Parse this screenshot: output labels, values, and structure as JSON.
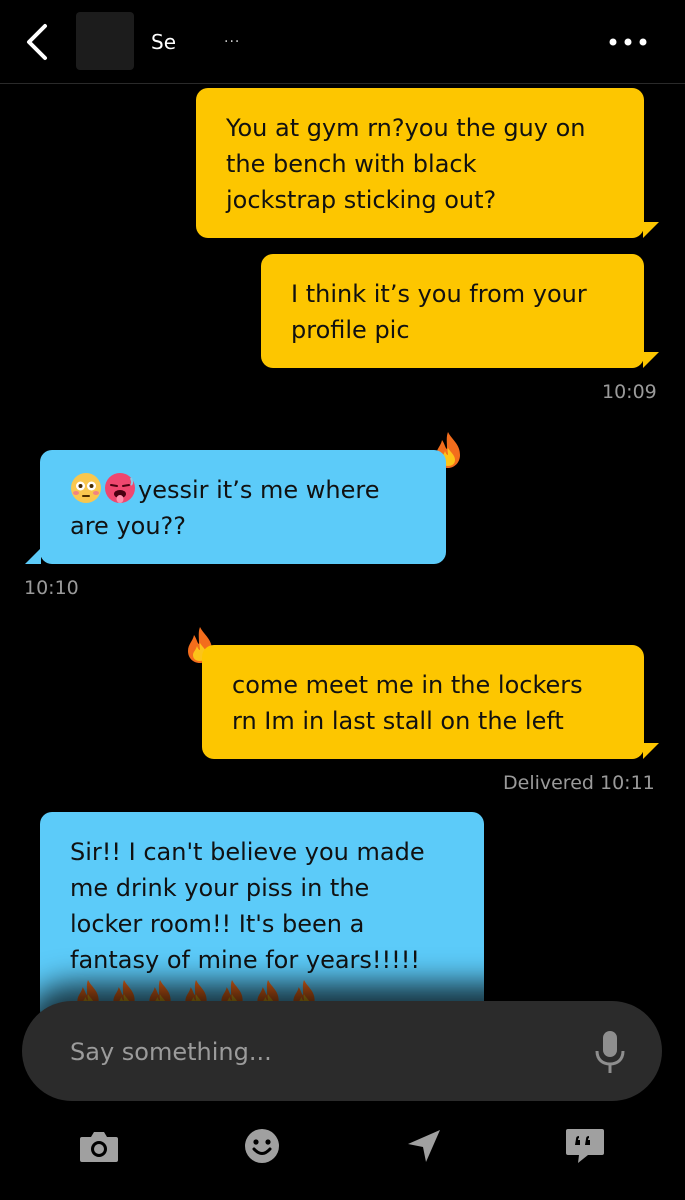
{
  "header": {
    "contact_name": "Se",
    "contact_extra": "...",
    "back_icon": "chevron-left-icon",
    "more_icon": "more-horizontal-icon"
  },
  "messages": [
    {
      "direction": "outgoing",
      "text": "You at gym rn?you the guy on the bench with black jockstrap sticking out?",
      "lines": [
        "You at gym rn?you the guy on",
        "the bench with black",
        "jockstrap sticking out?"
      ]
    },
    {
      "direction": "outgoing",
      "text": "I think it’s you from your profile pic",
      "lines": [
        "I think it’s you from your",
        "profile pic"
      ],
      "time": "10:09"
    },
    {
      "direction": "incoming",
      "emoji": [
        "flushed-face-emoji",
        "hot-face-emoji"
      ],
      "lines": [
        "yessir it’s me where",
        "are you??"
      ],
      "reaction": "fire-icon",
      "time": "10:10"
    },
    {
      "direction": "outgoing",
      "lines": [
        "come meet me in the lockers",
        "rn Im in last stall on the left"
      ],
      "reaction": "fire-icon",
      "status": "Delivered 10:11"
    },
    {
      "direction": "incoming",
      "lines": [
        "Sir!! I can't believe you made",
        "me drink your piss in the",
        "locker room!! It's been a",
        "fantasy of mine for years!!!!!"
      ],
      "trailing_emoji": "fire-emoji x7"
    }
  ],
  "composer": {
    "placeholder": "Say something...",
    "mic_icon": "microphone-icon"
  },
  "toolbar": [
    {
      "name": "camera-icon"
    },
    {
      "name": "smiley-icon"
    },
    {
      "name": "location-arrow-icon"
    },
    {
      "name": "quote-chat-icon"
    }
  ],
  "colors": {
    "outgoing_bubble": "#fdc600",
    "incoming_bubble": "#5ccbf9",
    "background": "#000000",
    "timestamp": "#9a9a9a"
  }
}
